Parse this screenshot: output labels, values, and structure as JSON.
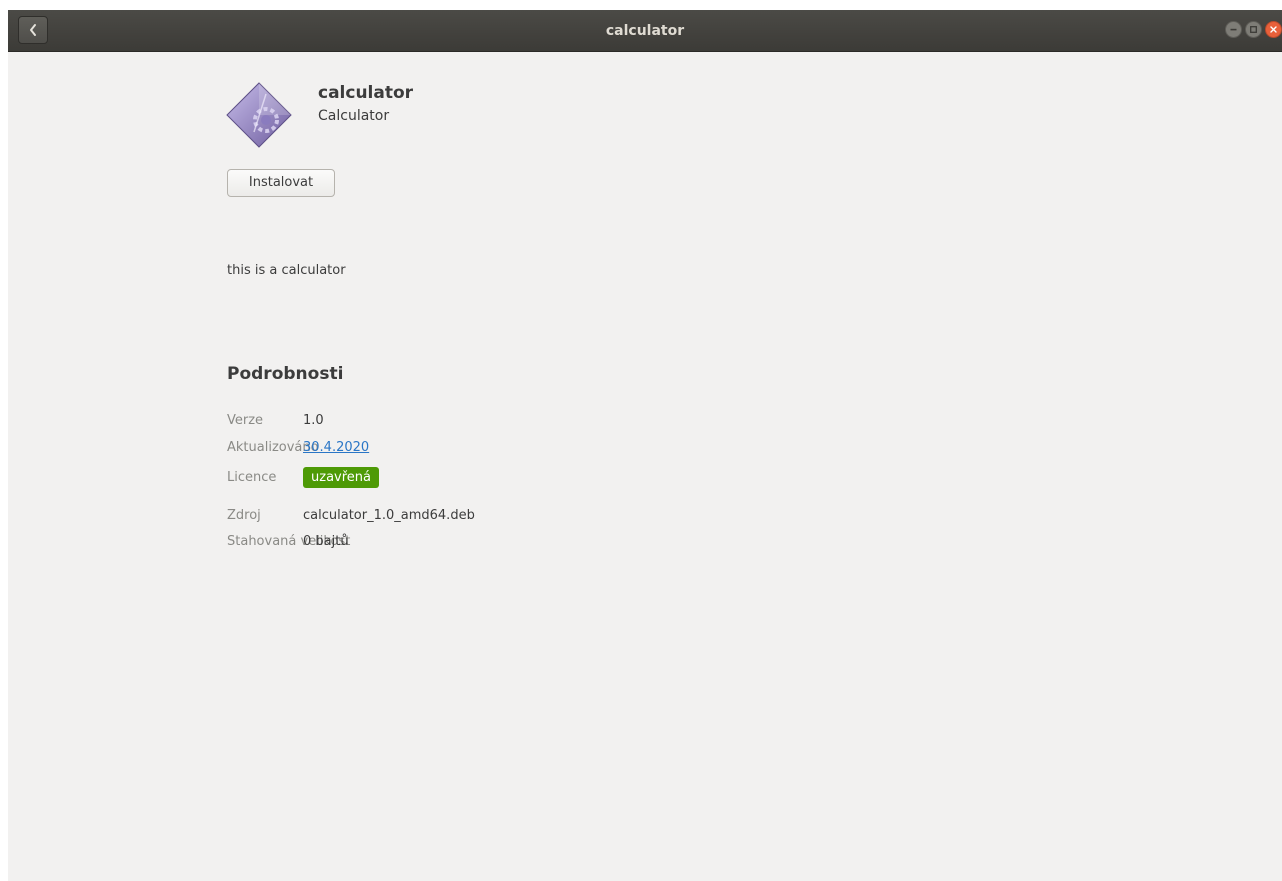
{
  "window": {
    "title": "calculator",
    "back_icon": "chevron-left-icon",
    "controls": [
      "minimize-icon",
      "maximize-icon",
      "close-icon"
    ],
    "close_color": "#e8603a"
  },
  "app": {
    "icon": "calculator-app-icon",
    "name": "calculator",
    "summary": "Calculator",
    "install_label": "Instalovat",
    "description": "this is a calculator"
  },
  "details": {
    "heading": "Podrobnosti",
    "version_label": "Verze",
    "version_value": "1.0",
    "updated_label": "Aktualizováno",
    "updated_value": "30.4.2020",
    "license_label": "Licence",
    "license_value": "uzavřená",
    "license_color": "#4e9a06",
    "source_label": "Zdroj",
    "source_value": "calculator_1.0_amd64.deb",
    "download_label": "Stahovaná velikost",
    "download_value": "0 bajtů"
  }
}
